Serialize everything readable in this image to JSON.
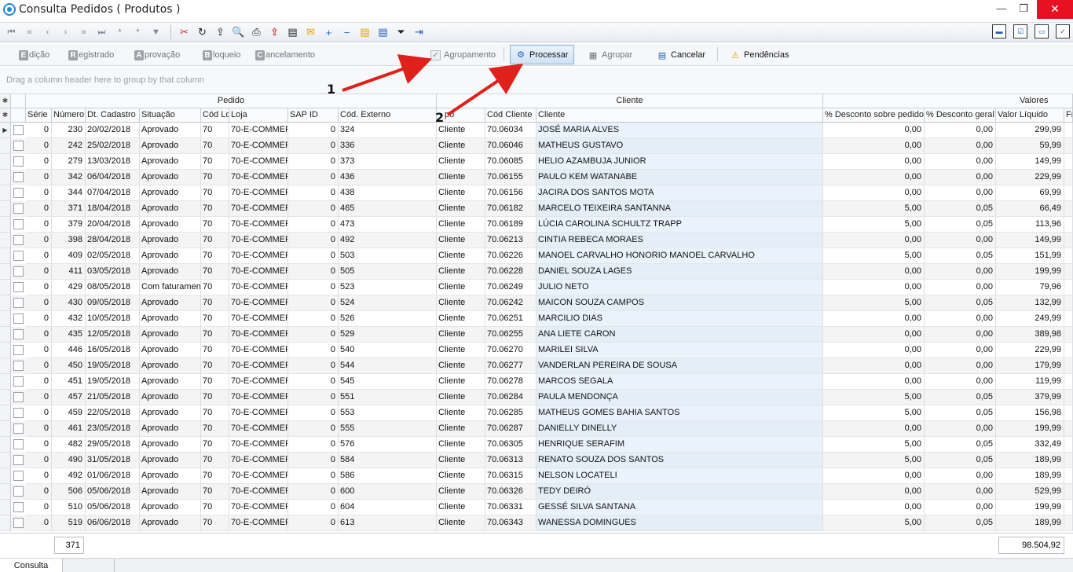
{
  "window": {
    "title": "Consulta Pedidos ( Produtos )",
    "min_glyph": "—",
    "max_glyph": "❐",
    "close_glyph": "✕"
  },
  "toolbar": {
    "nav_first": "⏮",
    "nav_prev_page": "«",
    "nav_prev": "‹",
    "nav_next": "›",
    "nav_next_page": "»",
    "nav_last": "⏭",
    "nav_insert": "*",
    "nav_append": "*",
    "nav_filter": "▼",
    "delete_glyph": "✂",
    "refresh_glyph": "↻",
    "export_glyph": "⇪",
    "preview_glyph": "🔍",
    "print_glyph": "⎙",
    "mail_glyph": "✉",
    "zoom_in_glyph": "+",
    "zoom_out_glyph": "−",
    "layout_glyph": "▤",
    "filter_glyph": "⏷",
    "exit_glyph": "⇥"
  },
  "actions": {
    "edicao": {
      "letter": "E",
      "rest": "dição"
    },
    "registrado": {
      "letter": "R",
      "rest": "egistrado"
    },
    "aprovacao": {
      "letter": "A",
      "rest": "provação"
    },
    "bloqueio": {
      "letter": "B",
      "rest": "loqueio"
    },
    "cancelamento": {
      "letter": "C",
      "rest": "ancelamento"
    },
    "agrupamento_label": "Agrupamento",
    "processar_label": "Processar",
    "agrupar_label": "Agrupar",
    "cancelar_label": "Cancelar",
    "pendencias_label": "Pendências"
  },
  "group_panel": {
    "hint": "Drag a column header here to group by that column"
  },
  "grid": {
    "bands": {
      "pedido": "Pedido",
      "cliente": "Cliente",
      "valores": "Valores"
    },
    "columns": {
      "serie": "Série",
      "numero": "Número",
      "dt_cadastro": "Dt. Cadastro",
      "situacao": "Situação",
      "cod_loja": "Cód Lo",
      "loja": "Loja",
      "sap_id": "SAP ID",
      "cod_externo": "Cód. Externo",
      "tipo": "po",
      "cod_cliente": "Cód Cliente",
      "cliente": "Cliente",
      "desc_pedido": "% Desconto sobre pedido",
      "desc_geral": "% Desconto geral",
      "valor_liquido": "Valor Líquido",
      "fr": "Fr"
    },
    "rows": [
      {
        "serie": "0",
        "numero": "230",
        "dt": "20/02/2018",
        "situacao": "Aprovado",
        "cod_loja": "70",
        "loja": "70-E-COMMER",
        "sap": "0",
        "ext": "324",
        "tipo": "Cliente",
        "cod_cli": "70.06034",
        "cliente": "JOSÉ MARIA ALVES",
        "dp": "0,00",
        "dg": "0,00",
        "vl": "299,99"
      },
      {
        "serie": "0",
        "numero": "242",
        "dt": "25/02/2018",
        "situacao": "Aprovado",
        "cod_loja": "70",
        "loja": "70-E-COMMER",
        "sap": "0",
        "ext": "336",
        "tipo": "Cliente",
        "cod_cli": "70.06046",
        "cliente": "MATHEUS GUSTAVO",
        "dp": "0,00",
        "dg": "0,00",
        "vl": "59,99"
      },
      {
        "serie": "0",
        "numero": "279",
        "dt": "13/03/2018",
        "situacao": "Aprovado",
        "cod_loja": "70",
        "loja": "70-E-COMMER",
        "sap": "0",
        "ext": "373",
        "tipo": "Cliente",
        "cod_cli": "70.06085",
        "cliente": "HELIO AZAMBUJA JUNIOR",
        "dp": "0,00",
        "dg": "0,00",
        "vl": "149,99"
      },
      {
        "serie": "0",
        "numero": "342",
        "dt": "06/04/2018",
        "situacao": "Aprovado",
        "cod_loja": "70",
        "loja": "70-E-COMMER",
        "sap": "0",
        "ext": "436",
        "tipo": "Cliente",
        "cod_cli": "70.06155",
        "cliente": "PAULO KEM WATANABE",
        "dp": "0,00",
        "dg": "0,00",
        "vl": "229,99"
      },
      {
        "serie": "0",
        "numero": "344",
        "dt": "07/04/2018",
        "situacao": "Aprovado",
        "cod_loja": "70",
        "loja": "70-E-COMMER",
        "sap": "0",
        "ext": "438",
        "tipo": "Cliente",
        "cod_cli": "70.06156",
        "cliente": "JACIRA DOS SANTOS MOTA",
        "dp": "0,00",
        "dg": "0,00",
        "vl": "69,99"
      },
      {
        "serie": "0",
        "numero": "371",
        "dt": "18/04/2018",
        "situacao": "Aprovado",
        "cod_loja": "70",
        "loja": "70-E-COMMER",
        "sap": "0",
        "ext": "465",
        "tipo": "Cliente",
        "cod_cli": "70.06182",
        "cliente": "MARCELO TEIXEIRA SANTANNA",
        "dp": "5,00",
        "dg": "0,05",
        "vl": "66,49"
      },
      {
        "serie": "0",
        "numero": "379",
        "dt": "20/04/2018",
        "situacao": "Aprovado",
        "cod_loja": "70",
        "loja": "70-E-COMMER",
        "sap": "0",
        "ext": "473",
        "tipo": "Cliente",
        "cod_cli": "70.06189",
        "cliente": "LÚCIA CAROLINA SCHULTZ TRAPP",
        "dp": "5,00",
        "dg": "0,05",
        "vl": "113,96"
      },
      {
        "serie": "0",
        "numero": "398",
        "dt": "28/04/2018",
        "situacao": "Aprovado",
        "cod_loja": "70",
        "loja": "70-E-COMMER",
        "sap": "0",
        "ext": "492",
        "tipo": "Cliente",
        "cod_cli": "70.06213",
        "cliente": "CINTIA REBECA MORAES",
        "dp": "0,00",
        "dg": "0,00",
        "vl": "149,99"
      },
      {
        "serie": "0",
        "numero": "409",
        "dt": "02/05/2018",
        "situacao": "Aprovado",
        "cod_loja": "70",
        "loja": "70-E-COMMER",
        "sap": "0",
        "ext": "503",
        "tipo": "Cliente",
        "cod_cli": "70.06226",
        "cliente": "MANOEL CARVALHO HONORIO MANOEL CARVALHO",
        "dp": "5,00",
        "dg": "0,05",
        "vl": "151,99"
      },
      {
        "serie": "0",
        "numero": "411",
        "dt": "03/05/2018",
        "situacao": "Aprovado",
        "cod_loja": "70",
        "loja": "70-E-COMMER",
        "sap": "0",
        "ext": "505",
        "tipo": "Cliente",
        "cod_cli": "70.06228",
        "cliente": "DANIEL SOUZA LAGES",
        "dp": "0,00",
        "dg": "0,00",
        "vl": "199,99"
      },
      {
        "serie": "0",
        "numero": "429",
        "dt": "08/05/2018",
        "situacao": "Com faturamen",
        "cod_loja": "70",
        "loja": "70-E-COMMER",
        "sap": "0",
        "ext": "523",
        "tipo": "Cliente",
        "cod_cli": "70.06249",
        "cliente": "JULIO NETO",
        "dp": "0,00",
        "dg": "0,00",
        "vl": "79,96"
      },
      {
        "serie": "0",
        "numero": "430",
        "dt": "09/05/2018",
        "situacao": "Aprovado",
        "cod_loja": "70",
        "loja": "70-E-COMMER",
        "sap": "0",
        "ext": "524",
        "tipo": "Cliente",
        "cod_cli": "70.06242",
        "cliente": "MAICON SOUZA CAMPOS",
        "dp": "5,00",
        "dg": "0,05",
        "vl": "132,99"
      },
      {
        "serie": "0",
        "numero": "432",
        "dt": "10/05/2018",
        "situacao": "Aprovado",
        "cod_loja": "70",
        "loja": "70-E-COMMER",
        "sap": "0",
        "ext": "526",
        "tipo": "Cliente",
        "cod_cli": "70.06251",
        "cliente": "MARCILIO DIAS",
        "dp": "0,00",
        "dg": "0,00",
        "vl": "249,99"
      },
      {
        "serie": "0",
        "numero": "435",
        "dt": "12/05/2018",
        "situacao": "Aprovado",
        "cod_loja": "70",
        "loja": "70-E-COMMER",
        "sap": "0",
        "ext": "529",
        "tipo": "Cliente",
        "cod_cli": "70.06255",
        "cliente": "ANA LIETE CARON",
        "dp": "0,00",
        "dg": "0,00",
        "vl": "389,98"
      },
      {
        "serie": "0",
        "numero": "446",
        "dt": "16/05/2018",
        "situacao": "Aprovado",
        "cod_loja": "70",
        "loja": "70-E-COMMER",
        "sap": "0",
        "ext": "540",
        "tipo": "Cliente",
        "cod_cli": "70.06270",
        "cliente": "MARILEI SILVA",
        "dp": "0,00",
        "dg": "0,00",
        "vl": "229,99"
      },
      {
        "serie": "0",
        "numero": "450",
        "dt": "19/05/2018",
        "situacao": "Aprovado",
        "cod_loja": "70",
        "loja": "70-E-COMMER",
        "sap": "0",
        "ext": "544",
        "tipo": "Cliente",
        "cod_cli": "70.06277",
        "cliente": "VANDERLAN PEREIRA DE SOUSA",
        "dp": "0,00",
        "dg": "0,00",
        "vl": "179,99"
      },
      {
        "serie": "0",
        "numero": "451",
        "dt": "19/05/2018",
        "situacao": "Aprovado",
        "cod_loja": "70",
        "loja": "70-E-COMMER",
        "sap": "0",
        "ext": "545",
        "tipo": "Cliente",
        "cod_cli": "70.06278",
        "cliente": "MARCOS SEGALA",
        "dp": "0,00",
        "dg": "0,00",
        "vl": "119,99"
      },
      {
        "serie": "0",
        "numero": "457",
        "dt": "21/05/2018",
        "situacao": "Aprovado",
        "cod_loja": "70",
        "loja": "70-E-COMMER",
        "sap": "0",
        "ext": "551",
        "tipo": "Cliente",
        "cod_cli": "70.06284",
        "cliente": "PAULA MENDONÇA",
        "dp": "5,00",
        "dg": "0,05",
        "vl": "379,99"
      },
      {
        "serie": "0",
        "numero": "459",
        "dt": "22/05/2018",
        "situacao": "Aprovado",
        "cod_loja": "70",
        "loja": "70-E-COMMER",
        "sap": "0",
        "ext": "553",
        "tipo": "Cliente",
        "cod_cli": "70.06285",
        "cliente": "MATHEUS GOMES BAHIA SANTOS",
        "dp": "5,00",
        "dg": "0,05",
        "vl": "156,98"
      },
      {
        "serie": "0",
        "numero": "461",
        "dt": "23/05/2018",
        "situacao": "Aprovado",
        "cod_loja": "70",
        "loja": "70-E-COMMER",
        "sap": "0",
        "ext": "555",
        "tipo": "Cliente",
        "cod_cli": "70.06287",
        "cliente": "DANIELLY DINELLY",
        "dp": "0,00",
        "dg": "0,00",
        "vl": "199,99"
      },
      {
        "serie": "0",
        "numero": "482",
        "dt": "29/05/2018",
        "situacao": "Aprovado",
        "cod_loja": "70",
        "loja": "70-E-COMMER",
        "sap": "0",
        "ext": "576",
        "tipo": "Cliente",
        "cod_cli": "70.06305",
        "cliente": "HENRIQUE SERAFIM",
        "dp": "5,00",
        "dg": "0,05",
        "vl": "332,49"
      },
      {
        "serie": "0",
        "numero": "490",
        "dt": "31/05/2018",
        "situacao": "Aprovado",
        "cod_loja": "70",
        "loja": "70-E-COMMER",
        "sap": "0",
        "ext": "584",
        "tipo": "Cliente",
        "cod_cli": "70.06313",
        "cliente": "RENATO SOUZA DOS SANTOS",
        "dp": "5,00",
        "dg": "0,05",
        "vl": "189,99"
      },
      {
        "serie": "0",
        "numero": "492",
        "dt": "01/06/2018",
        "situacao": "Aprovado",
        "cod_loja": "70",
        "loja": "70-E-COMMER",
        "sap": "0",
        "ext": "586",
        "tipo": "Cliente",
        "cod_cli": "70.06315",
        "cliente": "NELSON LOCATELI",
        "dp": "0,00",
        "dg": "0,00",
        "vl": "189,99"
      },
      {
        "serie": "0",
        "numero": "506",
        "dt": "05/06/2018",
        "situacao": "Aprovado",
        "cod_loja": "70",
        "loja": "70-E-COMMER",
        "sap": "0",
        "ext": "600",
        "tipo": "Cliente",
        "cod_cli": "70.06326",
        "cliente": "TEDY DEIRÓ",
        "dp": "0,00",
        "dg": "0,00",
        "vl": "529,99"
      },
      {
        "serie": "0",
        "numero": "510",
        "dt": "05/06/2018",
        "situacao": "Aprovado",
        "cod_loja": "70",
        "loja": "70-E-COMMER",
        "sap": "0",
        "ext": "604",
        "tipo": "Cliente",
        "cod_cli": "70.06331",
        "cliente": "GESSÉ SILVA SANTANA",
        "dp": "0,00",
        "dg": "0,00",
        "vl": "199,99"
      },
      {
        "serie": "0",
        "numero": "519",
        "dt": "06/06/2018",
        "situacao": "Aprovado",
        "cod_loja": "70",
        "loja": "70-E-COMMER",
        "sap": "0",
        "ext": "613",
        "tipo": "Cliente",
        "cod_cli": "70.06343",
        "cliente": "WANESSA DOMINGUES",
        "dp": "5,00",
        "dg": "0,05",
        "vl": "189,99"
      }
    ]
  },
  "footer": {
    "count": "371",
    "total": "98.504,92"
  },
  "statusbar": {
    "tab_label": "Consulta"
  },
  "annotations": {
    "one": "1",
    "two": "2",
    "arrow_color": "#e0201b"
  }
}
